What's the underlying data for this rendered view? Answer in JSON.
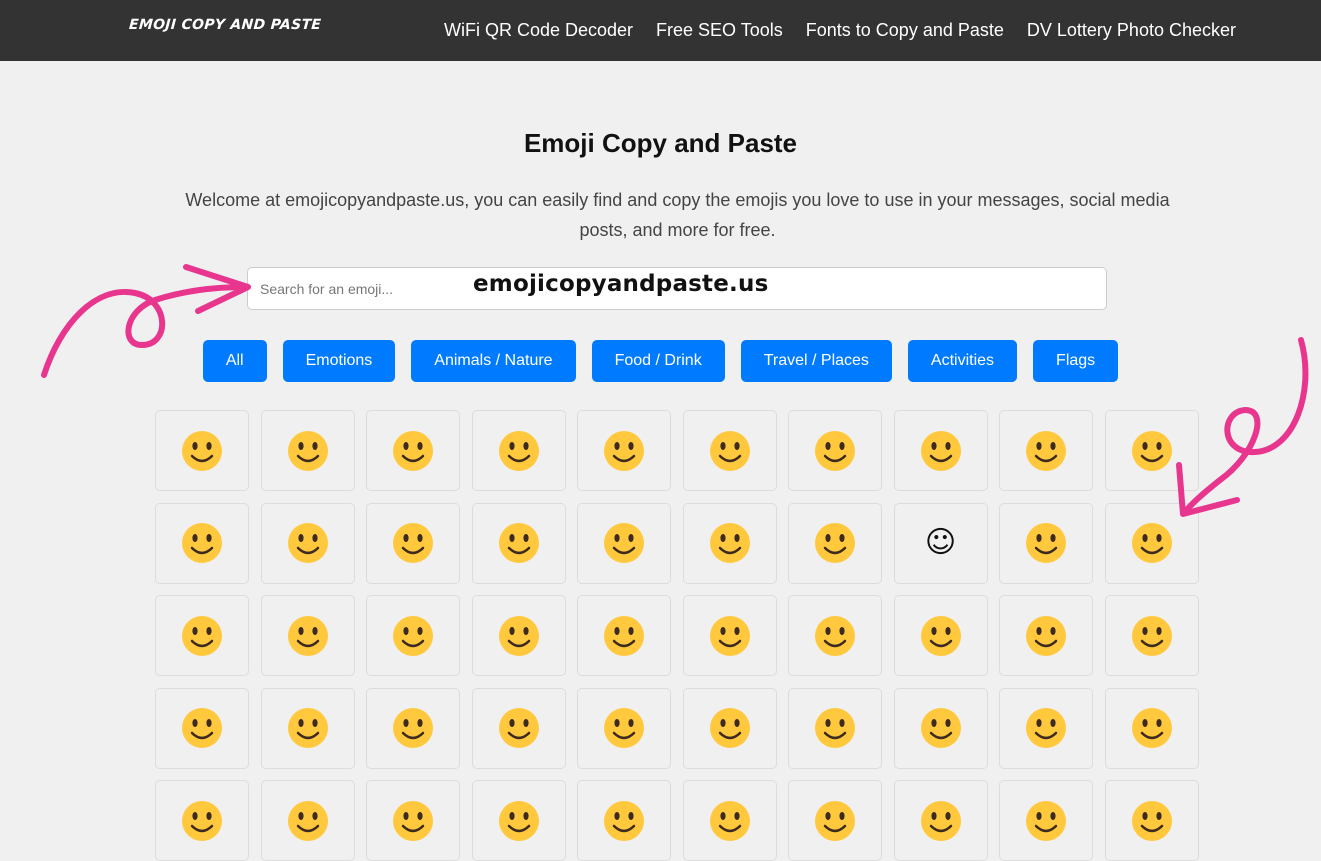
{
  "header": {
    "logo": "EMOJI COPY AND PASTE",
    "nav": [
      "WiFi QR Code Decoder",
      "Free SEO Tools",
      "Fonts to Copy and Paste",
      "DV Lottery Photo Checker"
    ]
  },
  "main": {
    "title": "Emoji Copy and Paste",
    "intro": "Welcome at emojicopyandpaste.us, you can easily find and copy the emojis you love to use in your messages, social media posts, and more for free.",
    "search_placeholder": "Search for an emoji...",
    "watermark": "emojicopyandpaste.us",
    "categories": [
      "All",
      "Emotions",
      "Animals / Nature",
      "Food / Drink",
      "Travel / Places",
      "Activities",
      "Flags"
    ],
    "emojis": [
      "😀",
      "😁",
      "😂",
      "🤣",
      "😃",
      "😄",
      "😅",
      "😆",
      "😉",
      "😊",
      "😋",
      "😎",
      "😍",
      "😘",
      "😗",
      "😙",
      "😚",
      "☺",
      "🙂",
      "🤗",
      "🤔",
      "😐",
      "😑",
      "😶",
      "🙄",
      "😏",
      "😣",
      "😥",
      "😮",
      "🤐",
      "😯",
      "😪",
      "😫",
      "😴",
      "😌",
      "😛",
      "😜",
      "😝",
      "🤤",
      "😒",
      "😓",
      "😔",
      "😕",
      "🙃",
      "🤑",
      "😲",
      "☹",
      "🙁",
      "😖",
      "😞"
    ]
  },
  "colors": {
    "topbar": "#333333",
    "accent": "#007bff",
    "emoji_face": "#ffc83d",
    "arrow": "#e8368f"
  }
}
